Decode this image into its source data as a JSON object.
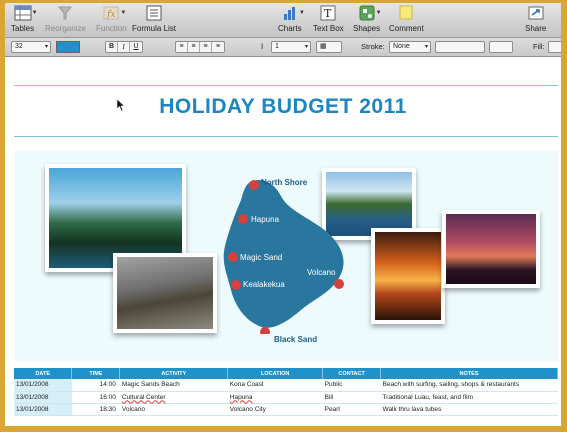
{
  "toolbar": {
    "tables": "Tables",
    "reorganize": "Reorganize",
    "function": "Function",
    "formula_list": "Formula List",
    "charts": "Charts",
    "text_box": "Text Box",
    "shapes": "Shapes",
    "comment": "Comment",
    "share": "Share"
  },
  "formatbar": {
    "font_size": "32",
    "bold": "B",
    "italic": "I",
    "underline": "U",
    "line_spacing": "1",
    "stroke_label": "Stroke:",
    "stroke_value": "None",
    "fill_label": "Fill:"
  },
  "document": {
    "title": "HOLIDAY BUDGET 2011",
    "map_places": [
      "North Shore",
      "Hapuna",
      "Magic Sand",
      "Kealakekua",
      "Volcano",
      "Black Sand"
    ]
  },
  "table": {
    "headers": [
      "DATE",
      "TIME",
      "ACTIVITY",
      "LOCATION",
      "CONTACT",
      "NOTES"
    ],
    "rows": [
      [
        "13/01/2008",
        "14:00",
        "Magic Sands  Beach",
        "Kona Coast",
        "Public",
        "Beach with surfing, sailing, shops & restaurants"
      ],
      [
        "13/01/2008",
        "16:00",
        "Cultural Center",
        "Hapuna",
        "Bill",
        "Traditional Luau, feast, and film"
      ],
      [
        "13/01/2008",
        "18:30",
        "Volcano",
        "Volcano City",
        "Pearl",
        "Walk thru lava tubes"
      ]
    ]
  },
  "colors": {
    "accent": "#1d86c0",
    "header": "#1f92c9",
    "border": "#d9a634"
  }
}
